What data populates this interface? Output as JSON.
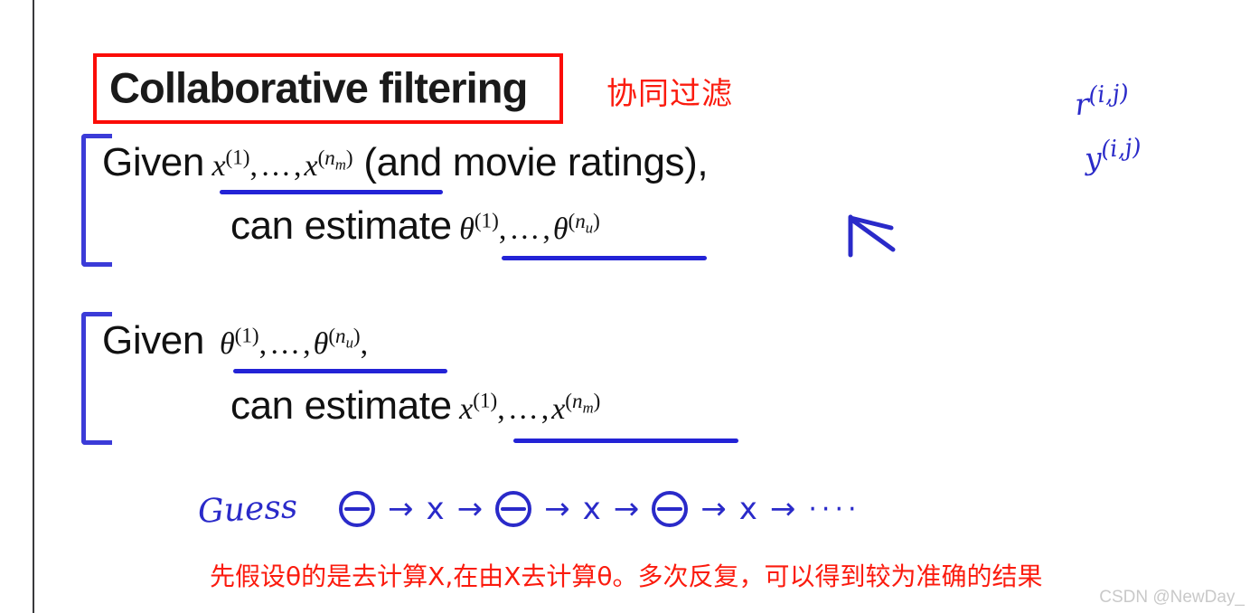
{
  "slide": {
    "title": "Collaborative filtering",
    "title_translation_cn": "协同过滤",
    "summary_cn": "先假设θ的是去计算X,在由X去计算θ。多次反复，可以得到较为准确的结果",
    "watermark": "CSDN @NewDay_"
  },
  "statements": [
    {
      "id": "given-x",
      "lead": "Given",
      "math": "x(1),…,x(nm)",
      "tail": "(and movie ratings),",
      "underlined": "x(1),…,x(nm)"
    },
    {
      "id": "estimate-theta",
      "lead": "can estimate",
      "math": "θ(1),…,θ(nu)",
      "tail": "",
      "underlined": "θ(1),…,θ(nu)"
    },
    {
      "id": "given-theta",
      "lead": "Given",
      "math": "θ(1),…,θ(nu),",
      "tail": "",
      "underlined": "θ(1),…,θ(nu)"
    },
    {
      "id": "estimate-x",
      "lead": "can estimate",
      "math": "x(1),…,x(nm)",
      "tail": "",
      "underlined": "x(1),…,x(nm)"
    }
  ],
  "text": {
    "given": "Given",
    "can_estimate": "can estimate",
    "and_movie_ratings": "(and movie ratings),",
    "comma": ",",
    "x_var": "x",
    "theta_var": "θ",
    "sup_one": "(1)",
    "sup_nm_open": "(",
    "sup_nm_n": "n",
    "sup_nm_sub": "m",
    "sup_nu_sub": "u",
    "sup_close": ")",
    "dots": ",…,"
  },
  "annotations": {
    "r_indicator": "r",
    "r_superscript": "(i,j)",
    "y_indicator": "y",
    "y_superscript": "(i,j)",
    "guess_label": "Guess",
    "iteration_sequence": [
      "θ",
      "→",
      "x",
      "→",
      "θ",
      "→",
      "x",
      "→",
      "θ",
      "→",
      "x",
      "→",
      "····"
    ],
    "arrow_symbol": "→",
    "ellipsis": "····",
    "up_left_arrow": "up-left-arrow"
  },
  "colors": {
    "red_accent": "#fb0c07",
    "blue_ink": "#2a2ac9",
    "text_black": "#111111",
    "rule_gray": "#3a3a3c",
    "watermark_gray": "#c9c9c9",
    "background": "#ffffff"
  }
}
